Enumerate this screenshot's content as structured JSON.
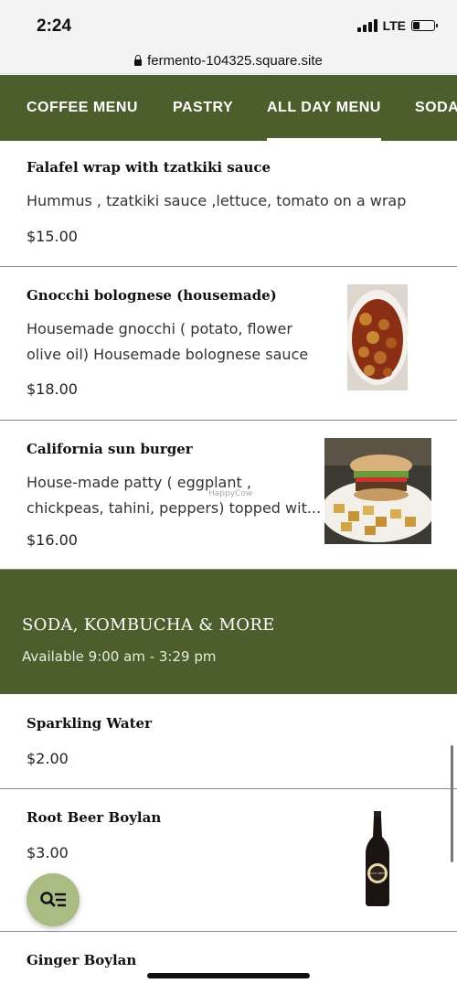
{
  "status": {
    "time": "2:24",
    "network": "LTE"
  },
  "browser": {
    "url": "fermento-104325.square.site"
  },
  "nav": {
    "tabs": [
      {
        "label": "COFFEE MENU"
      },
      {
        "label": "PASTRY"
      },
      {
        "label": "ALL DAY MENU",
        "active": true
      },
      {
        "label": "SODA"
      }
    ]
  },
  "items": [
    {
      "name": "Falafel wrap with tzatkiki sauce",
      "description": "Hummus , tzatkiki sauce ,lettuce, tomato on a wrap",
      "price": "$15.00"
    },
    {
      "name": "Gnocchi bolognese (housemade)",
      "description_line1": "Housemade gnocchi ( potato, flower",
      "description_line2": "olive oil) Housemade bolognese sauce",
      "price": "$18.00"
    },
    {
      "name": "California sun burger",
      "description_line1": "House-made patty ( eggplant ,",
      "description_line2": "chickpeas, tahini, peppers) topped wit...",
      "price": "$16.00",
      "watermark": "HappyCow"
    }
  ],
  "section": {
    "title": "SODA, KOMBUCHA & MORE",
    "availability": "Available 9:00 am - 3:29 pm"
  },
  "section_items": [
    {
      "name": "Sparkling Water",
      "price": "$2.00"
    },
    {
      "name": "Root Beer Boylan",
      "price": "$3.00",
      "bottle_label": "ROOT BEER"
    },
    {
      "name": "Ginger Boylan"
    }
  ],
  "fab": {
    "icon": "search-list-icon"
  },
  "colors": {
    "brand_green": "#4b5e2b",
    "fab_green": "#a8bc83"
  }
}
